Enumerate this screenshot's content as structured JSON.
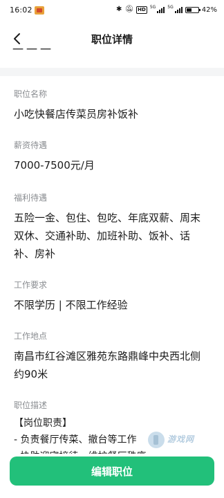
{
  "status_bar": {
    "time": "16:02",
    "battery": "42",
    "hd_label": "HD",
    "network_5g": "5G"
  },
  "nav": {
    "title": "职位详情"
  },
  "cut_text": "一一一",
  "fields": {
    "name": {
      "label": "职位名称",
      "value": "小吃快餐店传菜员房补饭补"
    },
    "salary": {
      "label": "薪资待遇",
      "value": "7000-7500元/月"
    },
    "benefit": {
      "label": "福利待遇",
      "lines": [
        "五险一金、包住、包吃、年底双薪、周末",
        "双休、交通补助、加班补助、饭补、话",
        "补、房补"
      ]
    },
    "requirement": {
      "label": "工作要求",
      "value": "不限学历 | 不限工作经验"
    },
    "address": {
      "label": "工作地点",
      "lines": [
        "南昌市红谷滩区雅苑东路鼎峰中央西北侧",
        "约90米"
      ]
    },
    "description": {
      "label": "职位描述",
      "lines": [
        "【岗位职责】",
        "- 负责餐厅传菜、撤台等工作",
        "- 协助迎宾接待、维护餐厅秩序"
      ]
    }
  },
  "watermark": {
    "text": "游戏网",
    "sub": ""
  },
  "actions": {
    "edit_label": "编辑职位"
  },
  "colors": {
    "accent": "#22c07a",
    "label_gray": "#8a8d91"
  }
}
